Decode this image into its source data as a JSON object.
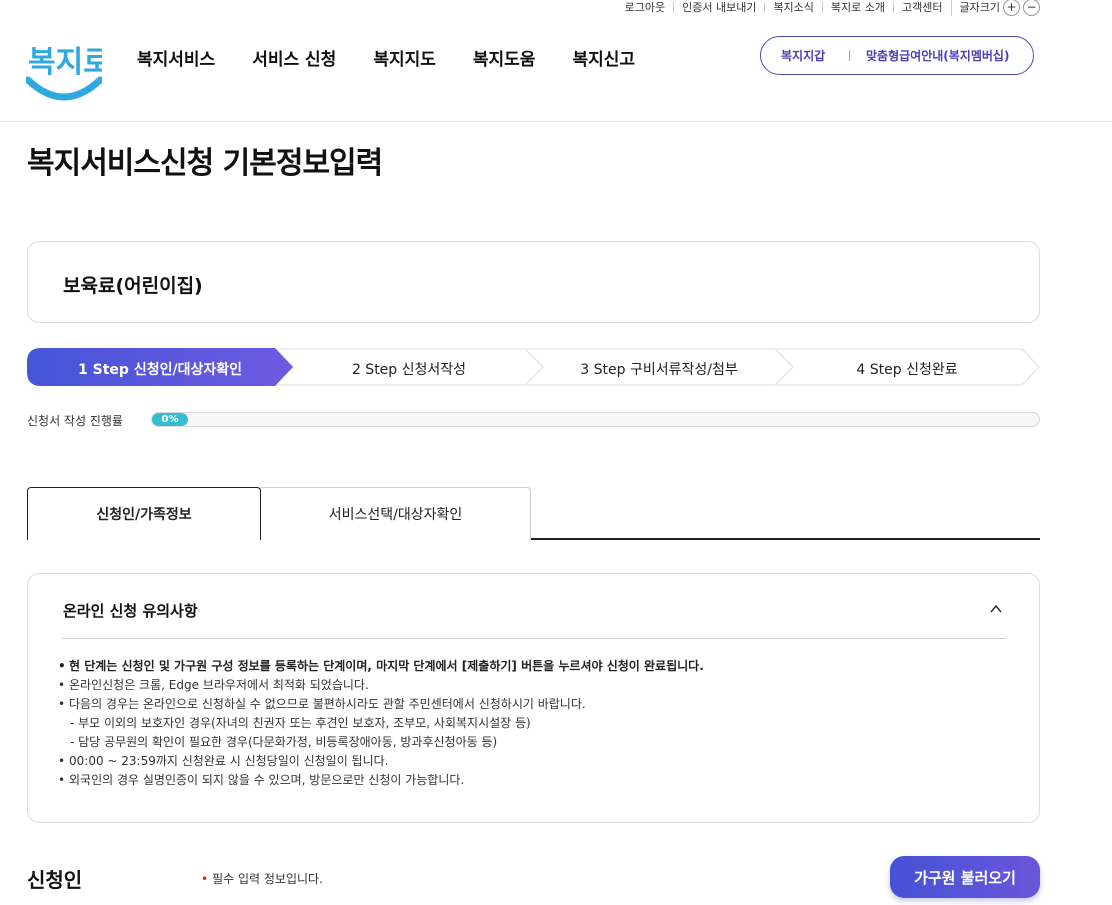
{
  "utility": {
    "items": [
      "로그아웃",
      "인증서 내보내기",
      "복지소식",
      "복지로 소개",
      "고객센터"
    ],
    "font_size_label": "글자크기",
    "plus": "+",
    "minus": "−"
  },
  "logo": {
    "text": "복지로",
    "color": "#2ea8e0"
  },
  "gnb": [
    "복지서비스",
    "서비스 신청",
    "복지지도",
    "복지도움",
    "복지신고"
  ],
  "pill": {
    "left": "복지지갑",
    "right": "맞춤형급여안내(복지멤버십)"
  },
  "page_title": "복지서비스신청 기본정보입력",
  "service_name": "보육료(어린이집)",
  "steps": [
    {
      "label": "1 Step 신청인/대상자확인",
      "active": true
    },
    {
      "label": "2 Step 신청서작성",
      "active": false
    },
    {
      "label": "3 Step 구비서류작성/첨부",
      "active": false
    },
    {
      "label": "4 Step 신청완료",
      "active": false
    }
  ],
  "progress": {
    "label": "신청서 작성 진행률",
    "value_text": "0%",
    "value": 0
  },
  "tabs": [
    "신청인/가족정보",
    "서비스선택/대상자확인"
  ],
  "notice": {
    "title": "온라인 신청 유의사항",
    "lines": [
      "현 단계는 신청인 및 가구원 구성 정보를 등록하는 단계이며, 마지막 단계에서 [제출하기] 버튼을 누르셔야 신청이 완료됩니다.",
      "온라인신청은 크롬, Edge 브라우저에서 최적화 되었습니다.",
      "다음의 경우는 온라인으로 신청하실 수 없으므로 불편하시라도 관할 주민센터에서 신청하시기 바랍니다.",
      "- 부모 이외의 보호자인 경우(자녀의 친권자 또는 후견인 보호자, 조부모, 사회복지시설장 등)",
      "- 담당 공무원의 확인이 필요한 경우(다문화가정, 비등록장애아동, 방과후신청아동 등)",
      "00:00 ~ 23:59까지 신청완료 시 신청당일이 신청일이 됩니다.",
      "외국인의 경우 실명인증이 되지 않을 수 있으며, 방문으로만 신청이 가능합니다."
    ]
  },
  "applicant": {
    "heading": "신청인",
    "required_note": "필수 입력 정보입니다.",
    "load_button": "가구원 불러오기"
  }
}
